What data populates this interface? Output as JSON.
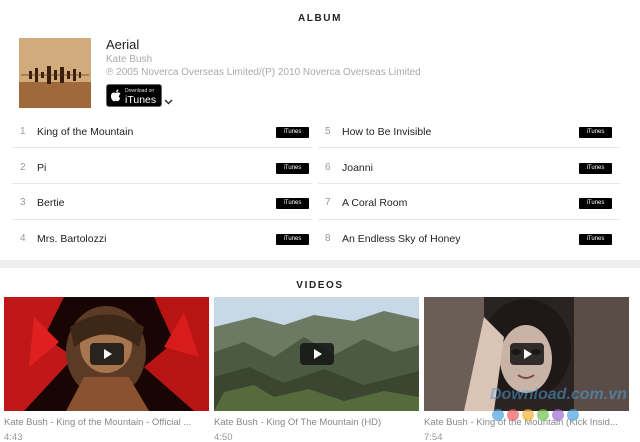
{
  "album": {
    "section_title": "ALBUM",
    "title": "Aerial",
    "artist": "Kate Bush",
    "copyright": "℗ 2005 Noverca Overseas Limited/(P) 2010 Noverca Overseas Limited",
    "itunes_badge": {
      "small": "Download on",
      "big": "iTunes"
    },
    "tracks_left": [
      {
        "num": "1",
        "title": "King of the Mountain",
        "button": "iTunes"
      },
      {
        "num": "2",
        "title": "Pi",
        "button": "iTunes"
      },
      {
        "num": "3",
        "title": "Bertie",
        "button": "iTunes"
      },
      {
        "num": "4",
        "title": "Mrs. Bartolozzi",
        "button": "iTunes"
      }
    ],
    "tracks_right": [
      {
        "num": "5",
        "title": "How to Be Invisible",
        "button": "iTunes"
      },
      {
        "num": "6",
        "title": "Joanni",
        "button": "iTunes"
      },
      {
        "num": "7",
        "title": "A Coral Room",
        "button": "iTunes"
      },
      {
        "num": "8",
        "title": "An Endless Sky of Honey",
        "button": "iTunes"
      }
    ]
  },
  "videos": {
    "section_title": "VIDEOS",
    "items": [
      {
        "title": "Kate Bush - King of the Mountain - Official ...",
        "duration": "4:43"
      },
      {
        "title": "Kate Bush - King Of The Mountain (HD)",
        "duration": "4:50"
      },
      {
        "title": "Kate Bush - King of the Mountain (Kick Insid...",
        "duration": "7:54"
      }
    ]
  },
  "watermark": "Download.com.vn",
  "watermark_dot_colors": [
    "#4aa3df",
    "#e85d5d",
    "#f2b134",
    "#6cc04a",
    "#9b6bd1",
    "#4aa3df"
  ]
}
